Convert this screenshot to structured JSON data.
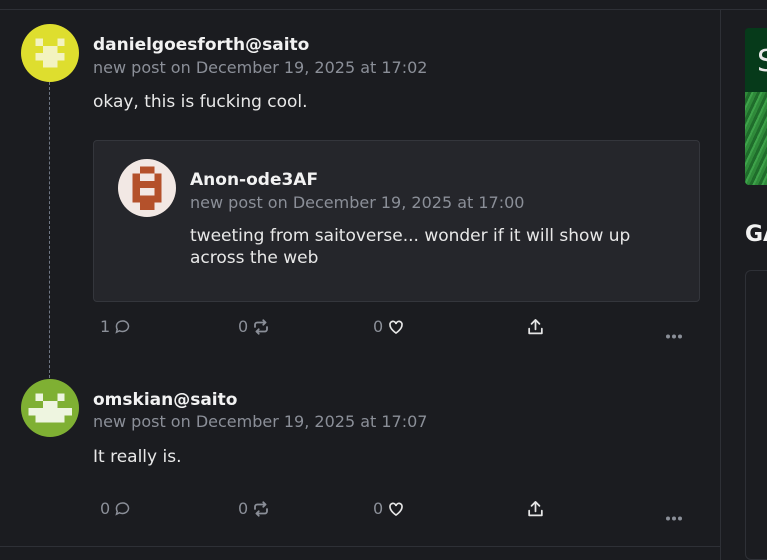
{
  "posts": [
    {
      "username": "danielgoesforth@saito",
      "meta": "new post on December 19, 2025 at 17:02",
      "text": "okay, this is fucking cool.",
      "quote": {
        "username": "Anon-ode3AF",
        "meta": "new post on December 19, 2025 at 17:00",
        "text": "tweeting from saitoverse... wonder if it will show up across the web"
      },
      "actions": {
        "replies": "1",
        "retweets": "0",
        "likes": "0"
      }
    },
    {
      "username": "omskian@saito",
      "meta": "new post on December 19, 2025 at 17:07",
      "text": "It really is.",
      "actions": {
        "replies": "0",
        "retweets": "0",
        "likes": "0"
      }
    }
  ],
  "sidebar": {
    "banner_letter": "S",
    "heading": "GA"
  },
  "icons": {
    "reply": "comment-icon",
    "retweet": "retweet-icon",
    "like": "heart-icon",
    "share": "share-icon",
    "more": "more-icon"
  },
  "colors": {
    "background": "#1b1c20",
    "card": "#25262b",
    "muted": "#8b8f98",
    "avatar1": "#dede2e",
    "avatar2": "#b4512b",
    "avatar3": "#7fb033"
  }
}
